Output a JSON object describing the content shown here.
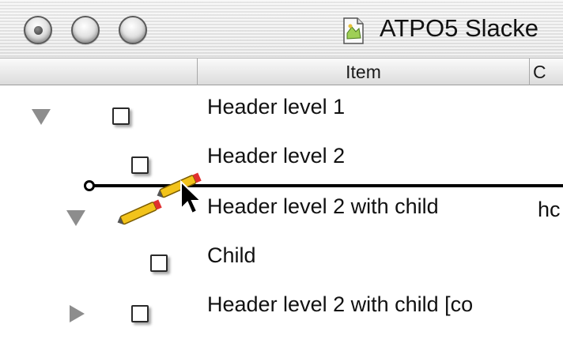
{
  "window": {
    "title": "ATPO5 Slacke",
    "doc_icon": "document-icon"
  },
  "columns": {
    "item": "Item",
    "next": "C"
  },
  "rows": [
    {
      "label": "Header level 1",
      "disclosure": "expanded",
      "checked": false
    },
    {
      "label": "Header level 2",
      "disclosure": "none",
      "checked": false
    },
    {
      "label": "Header level 2 with child",
      "disclosure": "expanded",
      "checked": false,
      "extra": "hc"
    },
    {
      "label": "Child",
      "disclosure": "none",
      "checked": false
    },
    {
      "label": "Header level 2 with child [co",
      "disclosure": "collapsed",
      "checked": false
    }
  ],
  "drag": {
    "icon": "pencil-icon",
    "cursor": "arrow-cursor-icon",
    "indicator": "drop-indicator-line"
  },
  "colors": {
    "disclosure": "#8d8d8d",
    "drop_line": "#000000",
    "pencil_body": "#f2c31b",
    "pencil_tip": "#e03030"
  }
}
